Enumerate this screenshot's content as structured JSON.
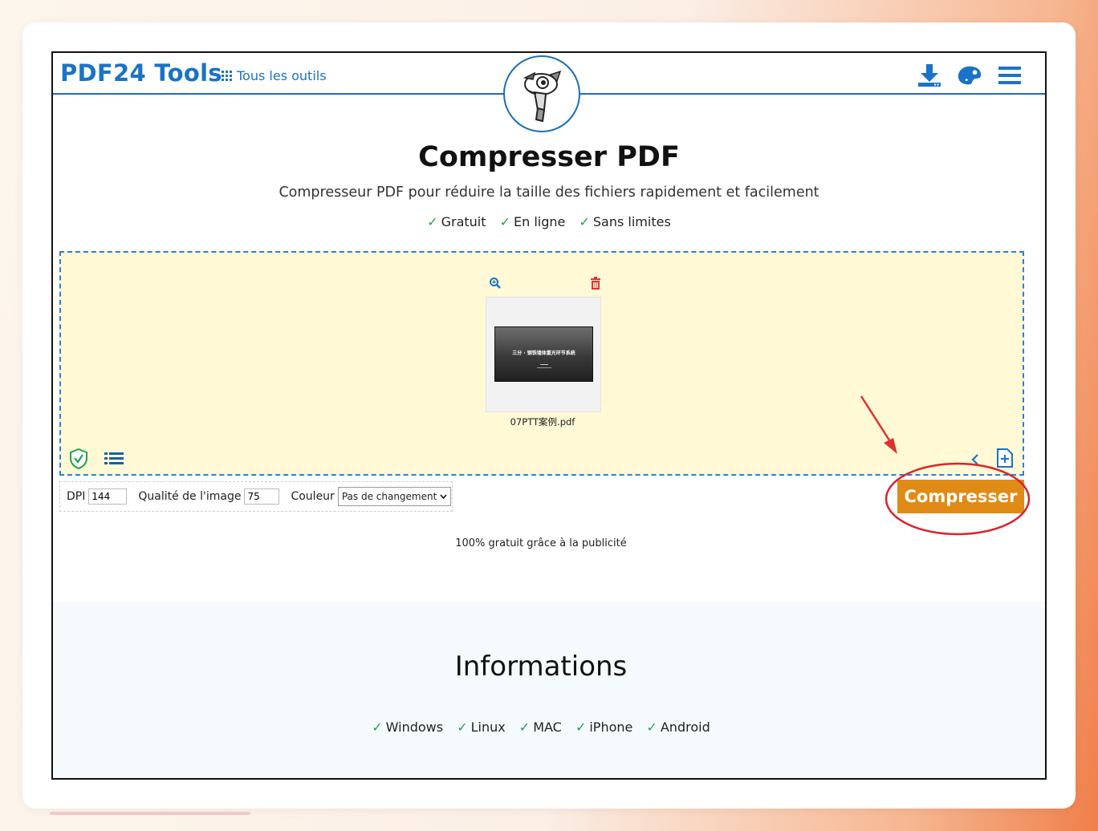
{
  "header": {
    "brand": "PDF24 Tools",
    "all_tools_label": "Tous les outils",
    "icons": [
      "download-icon",
      "palette-icon",
      "menu-icon"
    ]
  },
  "page": {
    "title": "Compresser PDF",
    "subtitle": "Compresseur PDF pour réduire la taille des fichiers rapidement et facilement",
    "features": [
      "Gratuit",
      "En ligne",
      "Sans limites"
    ],
    "tick": "✓"
  },
  "file": {
    "name": "07PTT案例.pdf",
    "slide_text": "三分 · 钢铁墙体重光环节系统"
  },
  "options": {
    "dpi_label": "DPI",
    "dpi_value": "144",
    "quality_label": "Qualité de l'image",
    "quality_value": "75",
    "color_label": "Couleur",
    "color_selected": "Pas de changement"
  },
  "actions": {
    "compress_label": "Compresser"
  },
  "notes": {
    "ad": "100% gratuit grâce à la publicité"
  },
  "info": {
    "title": "Informations",
    "platforms": [
      "Windows",
      "Linux",
      "MAC",
      "iPhone",
      "Android"
    ]
  },
  "colors": {
    "brand_blue": "#1a73c7",
    "accent_orange": "#e08b16",
    "dropzone_bg": "#fff9d6",
    "annotation_red": "#d9262c"
  }
}
